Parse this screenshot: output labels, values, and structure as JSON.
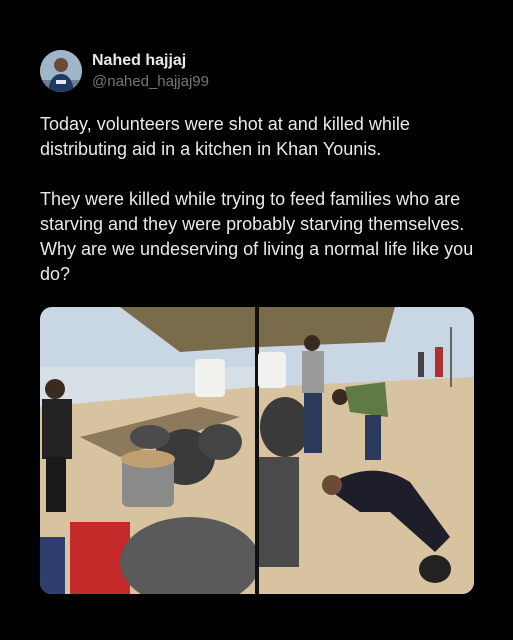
{
  "author": {
    "name": "Nahed hajjaj",
    "handle": "@nahed_hajjaj99",
    "avatar_icon": "profile-photo"
  },
  "tweet": {
    "text": "Today, volunteers were shot at and killed while distributing aid in a kitchen in Khan Younis.\n\nThey were killed while trying to feed families who are starving and they were probably starving themselves. Why are we undeserving of living a normal life like you do?"
  },
  "media": {
    "panels": [
      "left-photo",
      "right-photo"
    ],
    "colors": {
      "sand": "#d8c3a0",
      "tarp": "#7a6b4a",
      "sky": "#c9d7e4"
    }
  }
}
